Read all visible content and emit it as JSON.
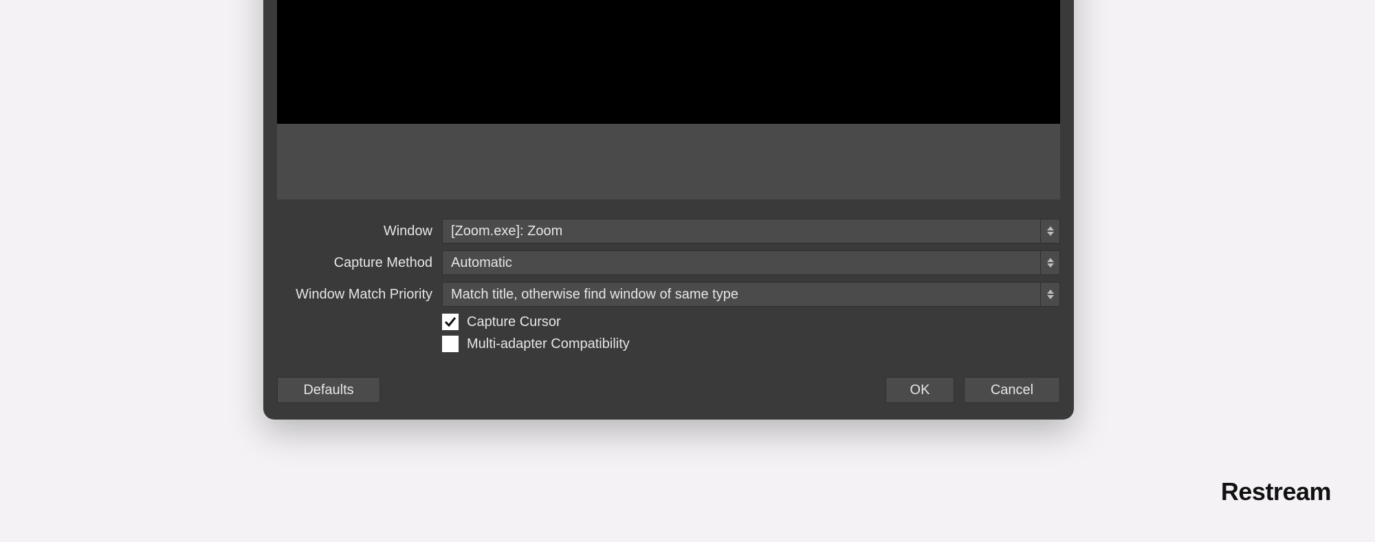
{
  "form": {
    "window_label": "Window",
    "window_value": "[Zoom.exe]: Zoom",
    "capture_method_label": "Capture Method",
    "capture_method_value": "Automatic",
    "window_match_priority_label": "Window Match Priority",
    "window_match_priority_value": "Match title, otherwise find window of same type",
    "capture_cursor_label": "Capture Cursor",
    "capture_cursor_checked": true,
    "multi_adapter_label": "Multi-adapter Compatibility",
    "multi_adapter_checked": false
  },
  "buttons": {
    "defaults": "Defaults",
    "ok": "OK",
    "cancel": "Cancel"
  },
  "watermark": "Restream"
}
